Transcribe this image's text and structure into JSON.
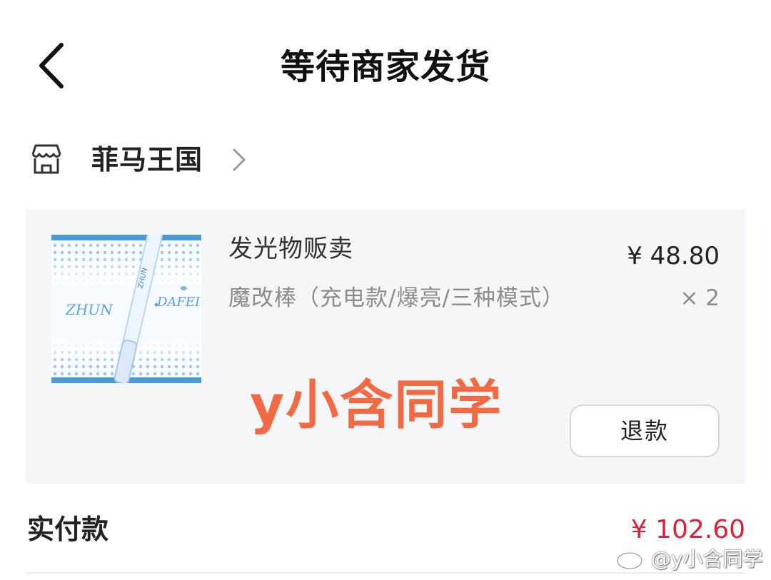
{
  "header": {
    "title": "等待商家发货",
    "back_icon": "chevron-left-icon"
  },
  "store": {
    "name": "菲马王国",
    "icon": "store-icon"
  },
  "order_item": {
    "title": "发光物贩卖",
    "price": "¥ 48.80",
    "spec": "魔改棒（充电款/爆亮/三种模式）",
    "quantity": "× 2",
    "refund_label": "退款",
    "thumb_text_left": "ZHUN",
    "thumb_text_right": "DAFEI",
    "thumb_stick_text": "ZHUN"
  },
  "overlay_text": "y小含同学",
  "summary": {
    "paid_label": "实付款",
    "paid_amount": "¥ 102.60"
  },
  "corner_mark": {
    "text": "@y小含同学",
    "icon": "weibo-icon"
  },
  "colors": {
    "price_red": "#d8213a",
    "overlay_orange": "#f16a44",
    "card_bg": "#f5f6f8",
    "secondary_gray": "#8c8c8c"
  }
}
